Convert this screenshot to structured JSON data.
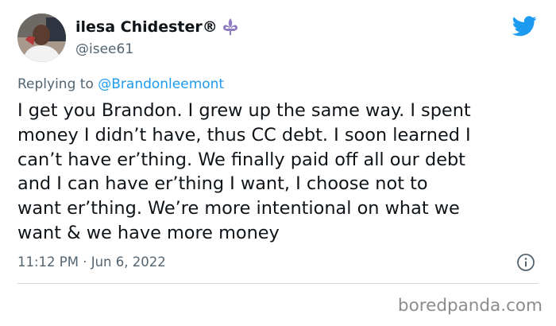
{
  "author": {
    "display_name": "ilesa Chidester®",
    "handle": "@isee61",
    "name_emoji_icon": "fleur-de-lis-icon"
  },
  "platform_icon": "twitter-bird-icon",
  "reply": {
    "prefix": "Replying to",
    "mention": "@Brandonleemont"
  },
  "tweet": {
    "lines": [
      "I get you Brandon. I grew up the same way. I spent",
      "money I didn’t have, thus CC debt. I soon learned I",
      "can’t have er’thing. We finally paid off all our debt",
      "and I can have er’thing I want, I choose not to",
      "want er’thing. We’re more intentional on what we",
      "want & we have more money"
    ],
    "timestamp": "11:12 PM · Jun 6, 2022"
  },
  "watermark": "boredpanda.com",
  "colors": {
    "text": "#0f1419",
    "secondary": "#536471",
    "link": "#1d9bf0",
    "fleur": "#8e7bc1"
  }
}
